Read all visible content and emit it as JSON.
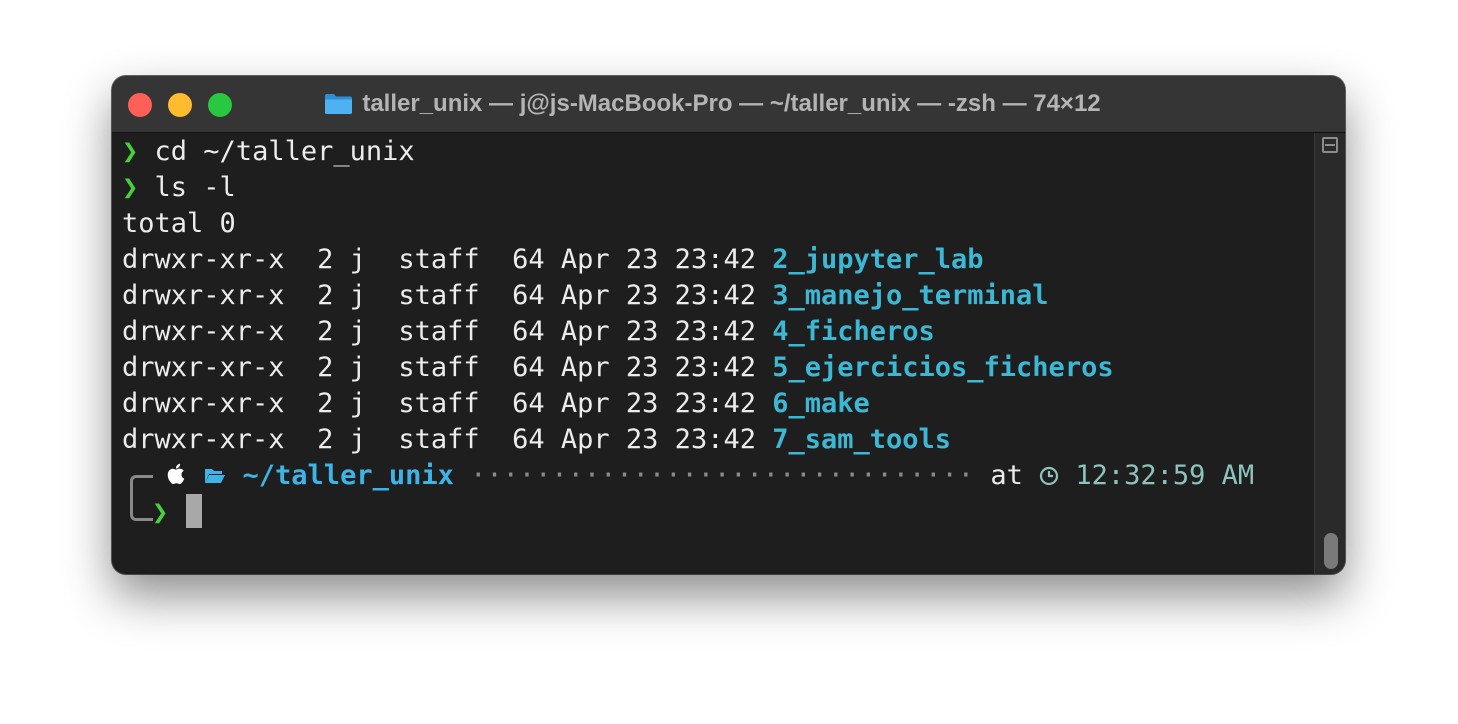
{
  "window": {
    "title": "taller_unix — j@js-MacBook-Pro — ~/taller_unix — -zsh — 74×12",
    "folder_icon": "folder-icon"
  },
  "colors": {
    "background": "#1e1e1e",
    "titlebar": "#353535",
    "prompt_arrow": "#48d03b",
    "directory": "#3cb8d4",
    "time": "#8cc3bd"
  },
  "terminal": {
    "prompt_symbol": "❯",
    "commands": [
      "cd ~/taller_unix",
      "ls -l"
    ],
    "total": "total 0",
    "listing": [
      {
        "meta": "drwxr-xr-x  2 j  staff  64 Apr 23 23:42 ",
        "name": "2_jupyter_lab"
      },
      {
        "meta": "drwxr-xr-x  2 j  staff  64 Apr 23 23:42 ",
        "name": "3_manejo_terminal"
      },
      {
        "meta": "drwxr-xr-x  2 j  staff  64 Apr 23 23:42 ",
        "name": "4_ficheros"
      },
      {
        "meta": "drwxr-xr-x  2 j  staff  64 Apr 23 23:42 ",
        "name": "5_ejercicios_ficheros"
      },
      {
        "meta": "drwxr-xr-x  2 j  staff  64 Apr 23 23:42 ",
        "name": "6_make"
      },
      {
        "meta": "drwxr-xr-x  2 j  staff  64 Apr 23 23:42 ",
        "name": "7_sam_tools"
      }
    ],
    "status_line": {
      "apple_icon": "apple-icon",
      "folder_icon": "open-folder-icon",
      "path": "~/taller_unix",
      "dots": "·······························",
      "at": "at",
      "clock_icon": "clock-icon",
      "time": "12:32:59 AM"
    }
  }
}
